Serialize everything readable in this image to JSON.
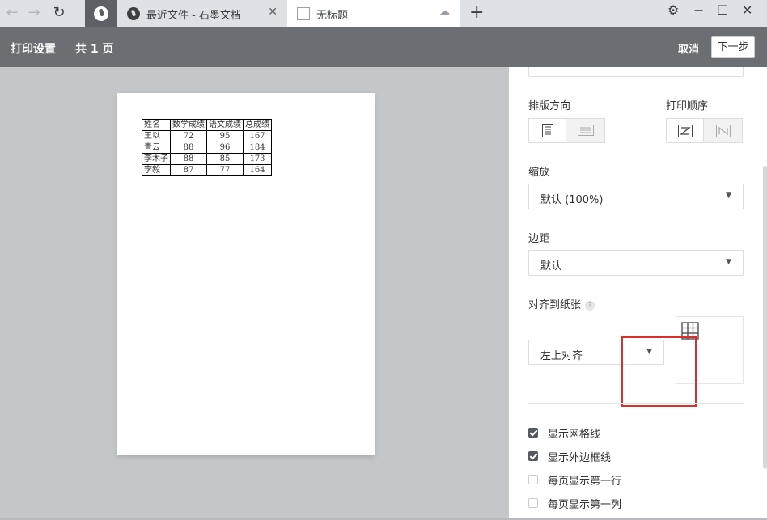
{
  "browser": {
    "tabs": [
      {
        "title": "最近文件 - 石墨文档",
        "close": "✕"
      },
      {
        "title": "无标题",
        "status": "cloud"
      }
    ],
    "new_tab": "+",
    "back": "←",
    "forward": "→",
    "reload": "↻",
    "settings": "⚙",
    "minimize": "−",
    "maximize": "☐",
    "close": "✕"
  },
  "header": {
    "title": "打印设置",
    "pages": "共 1 页",
    "cancel": "取消",
    "next": "下一步"
  },
  "preview_table": {
    "headers": [
      "姓名",
      "数学成绩",
      "语文成绩",
      "总成绩"
    ],
    "rows": [
      [
        "王以",
        "72",
        "95",
        "167"
      ],
      [
        "青云",
        "88",
        "96",
        "184"
      ],
      [
        "李木子",
        "88",
        "85",
        "173"
      ],
      [
        "李毅",
        "87",
        "77",
        "164"
      ]
    ]
  },
  "settings": {
    "orientation_label": "排版方向",
    "order_label": "打印顺序",
    "scale_label": "缩放",
    "scale_value": "默认 (100%)",
    "margin_label": "边距",
    "margin_value": "默认",
    "align_label": "对齐到纸张",
    "align_help": "?",
    "align_value": "左上对齐",
    "checkboxes": [
      {
        "label": "显示网格线",
        "checked": true
      },
      {
        "label": "显示外边框线",
        "checked": true
      },
      {
        "label": "每页显示第一行",
        "checked": false
      },
      {
        "label": "每页显示第一列",
        "checked": false
      }
    ]
  },
  "colors": {
    "header_bg": "#6b6f74",
    "highlight": "#d9302c",
    "check_fill": "#555a5f"
  }
}
